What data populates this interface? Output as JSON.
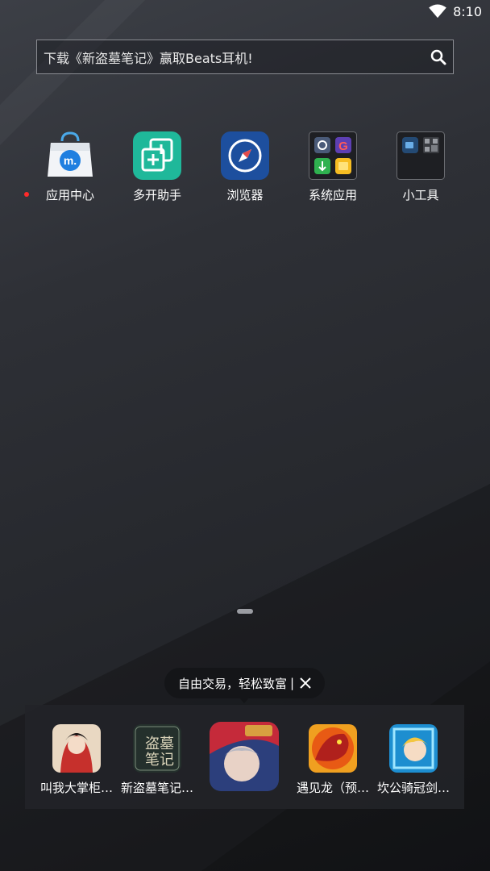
{
  "status_bar": {
    "time": "8:10",
    "wifi_icon": "wifi-icon"
  },
  "search": {
    "text": "下载《新盗墓笔记》赢取Beats耳机!",
    "icon": "search-icon"
  },
  "home_apps": [
    {
      "label": "应用中心",
      "icon": "app-center-icon",
      "badge": true
    },
    {
      "label": "多开助手",
      "icon": "multi-open-icon"
    },
    {
      "label": "浏览器",
      "icon": "browser-compass-icon"
    },
    {
      "label": "系统应用",
      "icon": "system-apps-folder-icon"
    },
    {
      "label": "小工具",
      "icon": "tools-folder-icon"
    }
  ],
  "tooltip": {
    "text": "自由交易，轻松致富",
    "close_icon": "close-icon"
  },
  "dock": {
    "games": [
      {
        "label": "叫我大掌柜…",
        "icon": "game-jiaowo-icon"
      },
      {
        "label": "新盗墓笔记…",
        "icon": "game-daomu-icon"
      },
      {
        "label": "",
        "icon": "game-featured-icon"
      },
      {
        "label": "遇见龙（预…",
        "icon": "game-dragon-icon"
      },
      {
        "label": "坎公骑冠剑…",
        "icon": "game-knight-icon"
      }
    ]
  },
  "colors": {
    "badge": "#ff2a2a",
    "tooltip_bg": "#141518",
    "dock_bg": "#222328"
  }
}
